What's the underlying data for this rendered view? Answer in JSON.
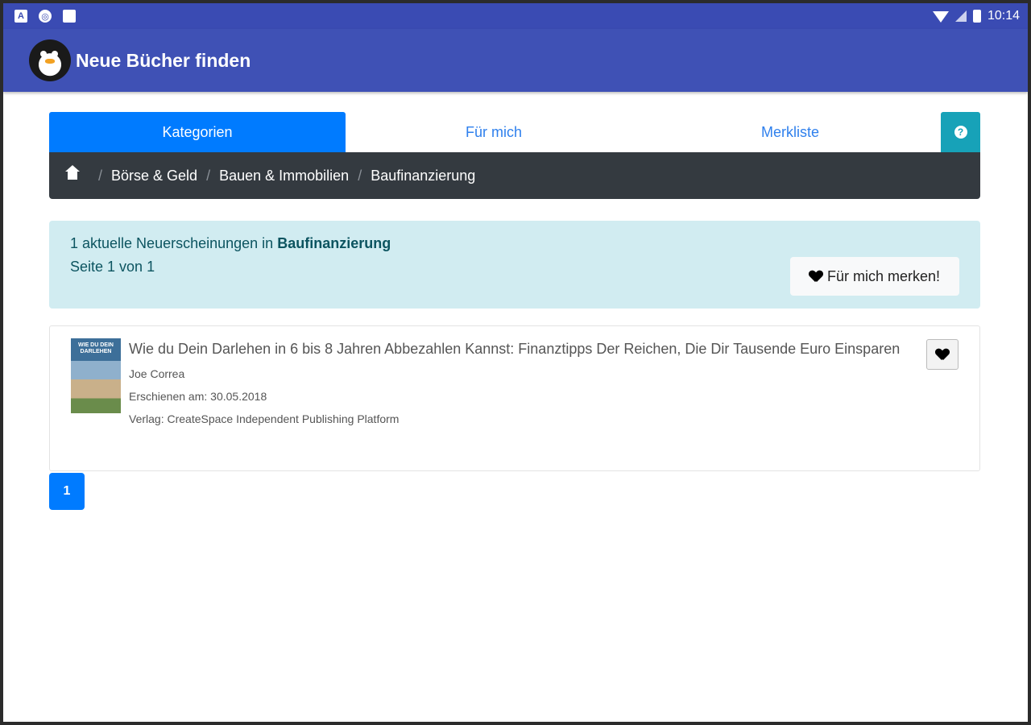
{
  "status_bar": {
    "time": "10:14",
    "left_icons": [
      "notification-a-icon",
      "sync-icon",
      "sd-card-icon"
    ],
    "right_icons": [
      "wifi-icon",
      "cell-signal-icon",
      "battery-icon"
    ]
  },
  "app_bar": {
    "title": "Neue Bücher finden",
    "logo_icon": "penguin-logo-icon",
    "background": "#3f51b5"
  },
  "tabs": [
    {
      "label": "Kategorien",
      "active": true
    },
    {
      "label": "Für mich",
      "active": false
    },
    {
      "label": "Merkliste",
      "active": false
    }
  ],
  "help_button": {
    "icon": "question-circle-icon",
    "color": "#17a2b8"
  },
  "breadcrumb": {
    "home_icon": "home-icon",
    "items": [
      "Börse & Geld",
      "Bauen & Immobilien",
      "Baufinanzierung"
    ],
    "separator": "/"
  },
  "info": {
    "count_text": "1 aktuelle Neuerscheinungen in",
    "category": "Baufinanzierung",
    "page_text": "Seite 1 von 1",
    "merken_label": "Für mich merken!"
  },
  "books": [
    {
      "title": "Wie du Dein Darlehen in 6 bis 8 Jahren Abbezahlen Kannst: Finanztipps Der Reichen, Die Dir Tausende Euro Einsparen",
      "author": "Joe Correa",
      "published": "Erschienen am: 30.05.2018",
      "publisher": "Verlag: CreateSpace Independent Publishing Platform",
      "cover_text": "WIE DU DEIN DARLEHEN"
    }
  ],
  "pagination": {
    "current": "1"
  },
  "colors": {
    "primary": "#007bff",
    "dark": "#343a40",
    "info_bg": "#d1ecf1",
    "info_text": "#0c5460"
  }
}
